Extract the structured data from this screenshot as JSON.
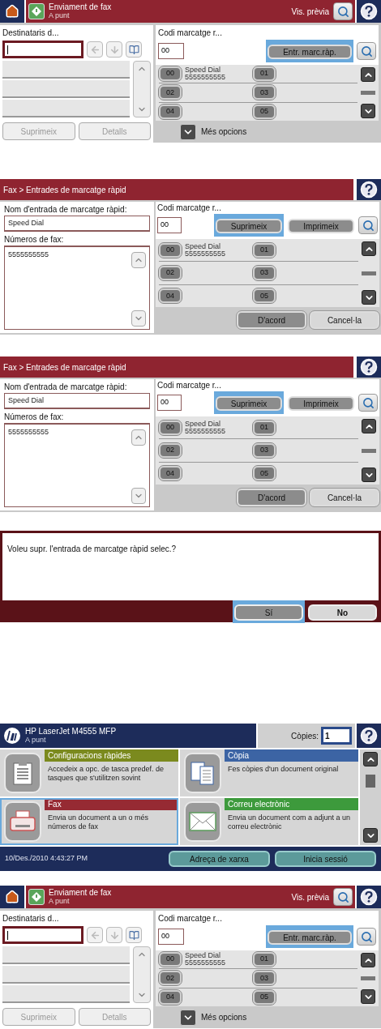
{
  "screens": [
    {
      "kind": "fax_send",
      "header": {
        "title": "Enviament de fax",
        "status": "A punt",
        "preview_label": "Vis. prèvia"
      },
      "recipients": {
        "label": "Destinataris d...",
        "buttons": [
          {
            "label": "Suprimeix",
            "disabled": true
          },
          {
            "label": "Detalls",
            "disabled": true
          }
        ]
      },
      "speed_dial": {
        "label": "Codi marcatge r...",
        "code": "00",
        "action": {
          "label": "Entr. marc.ràp.",
          "selected": true
        },
        "entries": [
          {
            "code": "00",
            "name": "Speed Dial",
            "number": "5555555555"
          },
          {
            "code": "01"
          },
          {
            "code": "02"
          },
          {
            "code": "03"
          },
          {
            "code": "04"
          },
          {
            "code": "05"
          }
        ]
      },
      "more_options": "Més opcions"
    },
    {
      "kind": "speed_dial_entry",
      "breadcrumb": "Fax > Entrades de marcatge ràpid",
      "name_label": "Nom d'entrada de marcatge ràpid:",
      "name_value": "Speed Dial",
      "numbers_label": "Números de fax:",
      "numbers_value": "5555555555",
      "code_label": "Codi marcatge r...",
      "code": "00",
      "buttons": [
        {
          "label": "Suprimeix",
          "selected": true
        },
        {
          "label": "Imprimeix",
          "selected": false
        }
      ],
      "entries": [
        {
          "code": "00",
          "name": "Speed Dial",
          "number": "5555555555"
        },
        {
          "code": "01"
        },
        {
          "code": "02"
        },
        {
          "code": "03"
        },
        {
          "code": "04"
        },
        {
          "code": "05"
        }
      ],
      "footer_buttons": [
        "D'acord",
        "Cancel·la"
      ]
    },
    {
      "kind": "speed_dial_entry",
      "breadcrumb": "Fax > Entrades de marcatge ràpid",
      "name_label": "Nom d'entrada de marcatge ràpid:",
      "name_value": "Speed Dial",
      "numbers_label": "Números de fax:",
      "numbers_value": "5555555555",
      "code_label": "Codi marcatge r...",
      "code": "00",
      "buttons": [
        {
          "label": "Suprimeix",
          "selected": true
        },
        {
          "label": "Imprimeix",
          "selected": false
        }
      ],
      "entries": [
        {
          "code": "00",
          "name": "Speed Dial",
          "number": "5555555555"
        },
        {
          "code": "01"
        },
        {
          "code": "02"
        },
        {
          "code": "03"
        },
        {
          "code": "04"
        },
        {
          "code": "05"
        }
      ],
      "footer_buttons": [
        "D'acord",
        "Cancel·la"
      ]
    },
    {
      "kind": "confirm_dialog",
      "message": "Voleu supr. l'entrada de marcatge ràpid selec.?",
      "buttons": [
        {
          "label": "Sí",
          "selected": true
        },
        {
          "label": "No",
          "selected": false
        }
      ]
    },
    {
      "kind": "home",
      "device": "HP LaserJet M4555 MFP",
      "status": "A punt",
      "copies_label": "Còpies:",
      "copies_value": "1",
      "tiles": [
        {
          "kind": "quick_sets",
          "title": "Configuracions ràpides",
          "description": "Accedeix a opc. de tasca predef. de tasques que s'utilitzen sovint",
          "color": "#7b8a1e",
          "selected": false
        },
        {
          "kind": "copy",
          "title": "Còpia",
          "description": "Fes còpies d'un document original",
          "color": "#3c64a4",
          "selected": false
        },
        {
          "kind": "fax",
          "title": "Fax",
          "description": "Envia un document a un o més números de fax",
          "color": "#962a33",
          "selected": true
        },
        {
          "kind": "email",
          "title": "Correu electrònic",
          "description": "Envia un document com a adjunt a un correu electrònic",
          "color": "#3d9a3c",
          "selected": false
        }
      ],
      "datetime": "10/Des./2010 4:43:27 PM",
      "footer_buttons": [
        "Adreça de xarxa",
        "Inicia sessió"
      ]
    },
    {
      "kind": "fax_send",
      "header": {
        "title": "Enviament de fax",
        "status": "A punt",
        "preview_label": "Vis. prèvia"
      },
      "recipients": {
        "label": "Destinataris d...",
        "buttons": [
          {
            "label": "Suprimeix",
            "disabled": true
          },
          {
            "label": "Detalls",
            "disabled": true
          }
        ]
      },
      "speed_dial": {
        "label": "Codi marcatge r...",
        "code": "00",
        "action": {
          "label": "Entr. marc.ràp.",
          "selected": true
        },
        "entries": [
          {
            "code": "00",
            "name": "Speed Dial",
            "number": "5555555555"
          },
          {
            "code": "01"
          },
          {
            "code": "02"
          },
          {
            "code": "03"
          },
          {
            "code": "04"
          },
          {
            "code": "05"
          }
        ]
      },
      "more_options": "Més opcions"
    }
  ]
}
